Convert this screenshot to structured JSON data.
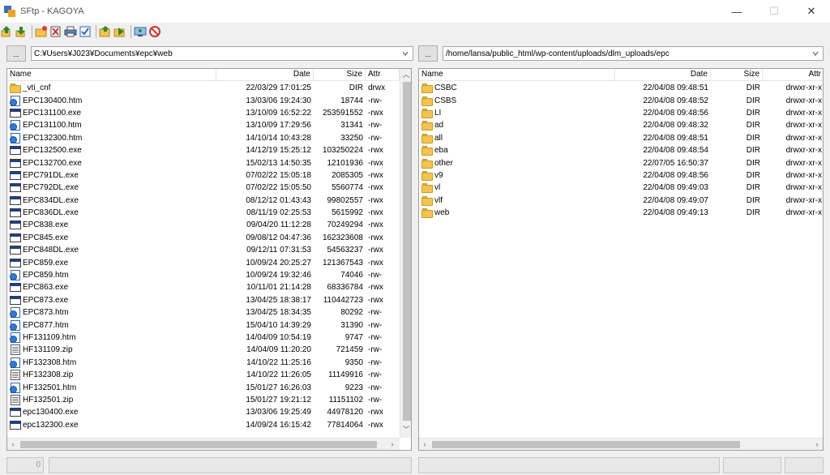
{
  "window": {
    "title": "SFtp - KAGOYA",
    "minimize": "—",
    "maximize": "☐",
    "close": "✕"
  },
  "left": {
    "path_button": "...",
    "path": "C:¥Users¥J023¥Documents¥epc¥web",
    "columns": [
      "Name",
      "Date",
      "Size",
      "Attr"
    ],
    "rows": [
      {
        "icon": "folder",
        "name": "_vti_cnf",
        "date": "22/03/29 17:01:25",
        "size": "DIR",
        "attr": "drwx"
      },
      {
        "icon": "htm",
        "name": "EPC130400.htm",
        "date": "13/03/06 19:24:30",
        "size": "18744",
        "attr": "-rw-"
      },
      {
        "icon": "exe",
        "name": "EPC131100.exe",
        "date": "13/10/09 16:52:22",
        "size": "253591552",
        "attr": "-rwx"
      },
      {
        "icon": "htm",
        "name": "EPC131100.htm",
        "date": "13/10/09 17:29:56",
        "size": "31341",
        "attr": "-rw-"
      },
      {
        "icon": "htm",
        "name": "EPC132300.htm",
        "date": "14/10/14 10:43:28",
        "size": "33250",
        "attr": "-rw-"
      },
      {
        "icon": "exe",
        "name": "EPC132500.exe",
        "date": "14/12/19 15:25:12",
        "size": "103250224",
        "attr": "-rwx"
      },
      {
        "icon": "exe",
        "name": "EPC132700.exe",
        "date": "15/02/13 14:50:35",
        "size": "12101936",
        "attr": "-rwx"
      },
      {
        "icon": "exe",
        "name": "EPC791DL.exe",
        "date": "07/02/22 15:05:18",
        "size": "2085305",
        "attr": "-rwx"
      },
      {
        "icon": "exe",
        "name": "EPC792DL.exe",
        "date": "07/02/22 15:05:50",
        "size": "5560774",
        "attr": "-rwx"
      },
      {
        "icon": "exe",
        "name": "EPC834DL.exe",
        "date": "08/12/12 01:43:43",
        "size": "99802557",
        "attr": "-rwx"
      },
      {
        "icon": "exe",
        "name": "EPC836DL.exe",
        "date": "08/11/19 02:25:53",
        "size": "5615992",
        "attr": "-rwx"
      },
      {
        "icon": "exe",
        "name": "EPC838.exe",
        "date": "09/04/20 11:12:28",
        "size": "70249294",
        "attr": "-rwx"
      },
      {
        "icon": "exe",
        "name": "EPC845.exe",
        "date": "09/08/12 04:47:36",
        "size": "162323608",
        "attr": "-rwx"
      },
      {
        "icon": "exe",
        "name": "EPC848DL.exe",
        "date": "09/12/11 07:31:53",
        "size": "54563237",
        "attr": "-rwx"
      },
      {
        "icon": "exe",
        "name": "EPC859.exe",
        "date": "10/09/24 20:25:27",
        "size": "121367543",
        "attr": "-rwx"
      },
      {
        "icon": "htm",
        "name": "EPC859.htm",
        "date": "10/09/24 19:32:46",
        "size": "74046",
        "attr": "-rw-"
      },
      {
        "icon": "exe",
        "name": "EPC863.exe",
        "date": "10/11/01 21:14:28",
        "size": "68336784",
        "attr": "-rwx"
      },
      {
        "icon": "exe",
        "name": "EPC873.exe",
        "date": "13/04/25 18:38:17",
        "size": "110442723",
        "attr": "-rwx"
      },
      {
        "icon": "htm",
        "name": "EPC873.htm",
        "date": "13/04/25 18:34:35",
        "size": "80292",
        "attr": "-rw-"
      },
      {
        "icon": "htm",
        "name": "EPC877.htm",
        "date": "15/04/10 14:39:29",
        "size": "31390",
        "attr": "-rw-"
      },
      {
        "icon": "htm",
        "name": "HF131109.htm",
        "date": "14/04/09 10:54:19",
        "size": "9747",
        "attr": "-rw-"
      },
      {
        "icon": "zip",
        "name": "HF131109.zip",
        "date": "14/04/09 11:20:20",
        "size": "721459",
        "attr": "-rw-"
      },
      {
        "icon": "htm",
        "name": "HF132308.htm",
        "date": "14/10/22 11:25:16",
        "size": "9350",
        "attr": "-rw-"
      },
      {
        "icon": "zip",
        "name": "HF132308.zip",
        "date": "14/10/22 11:26:05",
        "size": "11149916",
        "attr": "-rw-"
      },
      {
        "icon": "htm",
        "name": "HF132501.htm",
        "date": "15/01/27 16:26:03",
        "size": "9223",
        "attr": "-rw-"
      },
      {
        "icon": "zip",
        "name": "HF132501.zip",
        "date": "15/01/27 19:21:12",
        "size": "11151102",
        "attr": "-rw-"
      },
      {
        "icon": "exe",
        "name": "epc130400.exe",
        "date": "13/03/06 19:25:49",
        "size": "44978120",
        "attr": "-rwx"
      },
      {
        "icon": "exe",
        "name": "epc132300.exe",
        "date": "14/09/24 16:15:42",
        "size": "77814064",
        "attr": "-rwx"
      }
    ]
  },
  "right": {
    "path_button": "...",
    "path": "/home/lansa/public_html/wp-content/uploads/dlm_uploads/epc",
    "columns": [
      "Name",
      "Date",
      "Size",
      "Attr"
    ],
    "rows": [
      {
        "icon": "folder",
        "name": "CSBC",
        "date": "22/04/08 09:48:51",
        "size": "DIR",
        "attr": "drwxr-xr-x"
      },
      {
        "icon": "folder",
        "name": "CSBS",
        "date": "22/04/08 09:48:52",
        "size": "DIR",
        "attr": "drwxr-xr-x"
      },
      {
        "icon": "folder",
        "name": "LI",
        "date": "22/04/08 09:48:56",
        "size": "DIR",
        "attr": "drwxr-xr-x"
      },
      {
        "icon": "folder",
        "name": "ad",
        "date": "22/04/08 09:48:32",
        "size": "DIR",
        "attr": "drwxr-xr-x"
      },
      {
        "icon": "folder",
        "name": "all",
        "date": "22/04/08 09:48:51",
        "size": "DIR",
        "attr": "drwxr-xr-x"
      },
      {
        "icon": "folder",
        "name": "eba",
        "date": "22/04/08 09:48:54",
        "size": "DIR",
        "attr": "drwxr-xr-x"
      },
      {
        "icon": "folder",
        "name": "other",
        "date": "22/07/05 16:50:37",
        "size": "DIR",
        "attr": "drwxr-xr-x"
      },
      {
        "icon": "folder",
        "name": "v9",
        "date": "22/04/08 09:48:56",
        "size": "DIR",
        "attr": "drwxr-xr-x"
      },
      {
        "icon": "folder",
        "name": "vl",
        "date": "22/04/08 09:49:03",
        "size": "DIR",
        "attr": "drwxr-xr-x"
      },
      {
        "icon": "folder",
        "name": "vlf",
        "date": "22/04/08 09:49:07",
        "size": "DIR",
        "attr": "drwxr-xr-x"
      },
      {
        "icon": "folder",
        "name": "web",
        "date": "22/04/08 09:49:13",
        "size": "DIR",
        "attr": "drwxr-xr-x"
      }
    ]
  },
  "status": {
    "left_count": "0"
  },
  "toolbar_icons": [
    "upload-icon",
    "download-icon",
    "new-folder-icon",
    "delete-icon",
    "print-icon",
    "checkbox-icon",
    "open-folder-icon",
    "go-icon",
    "connect-icon",
    "disconnect-icon"
  ]
}
